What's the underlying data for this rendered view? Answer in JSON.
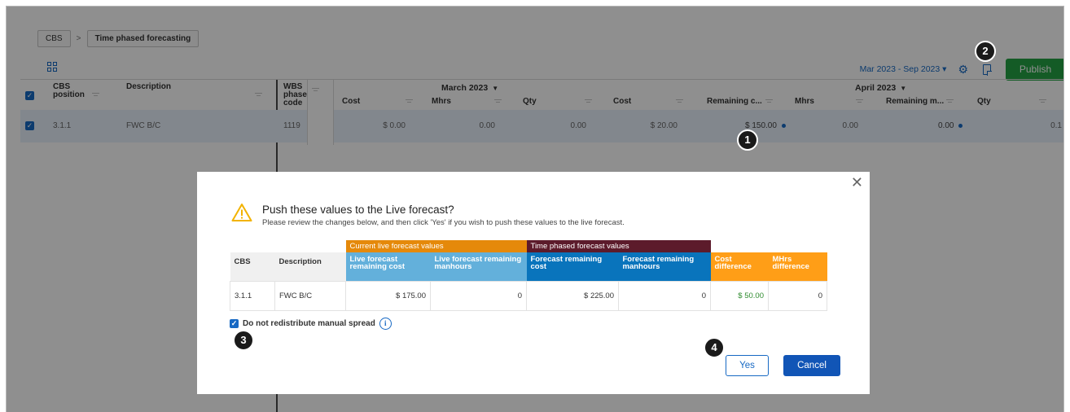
{
  "breadcrumb": {
    "root": "CBS",
    "separator": ">",
    "current": "Time phased forecasting"
  },
  "toolbar": {
    "date_range": "Mar 2023 - Sep 2023 ▾",
    "publish_label": "Publish"
  },
  "grid": {
    "headers": {
      "cbs_position": "CBS position",
      "description": "Description",
      "wbs": "WBS phase code",
      "month1": "March 2023",
      "month2": "April 2023",
      "cols_m1": [
        "Cost",
        "Mhrs",
        "Qty"
      ],
      "cols_m2": [
        "Cost",
        "Remaining c...",
        "Mhrs",
        "Remaining m...",
        "Qty"
      ]
    },
    "row": {
      "cbs": "3.1.1",
      "description": "FWC B/C",
      "wbs": "1119",
      "m1_cost": "$ 0.00",
      "m1_mhrs": "0.00",
      "m1_qty": "0.00",
      "m2_cost": "$ 20.00",
      "m2_rem_cost": "$ 150.00",
      "m2_mhrs": "0.00",
      "m2_rem_mhrs": "0.00",
      "m2_qty": "0.1"
    }
  },
  "modal": {
    "title": "Push these values to the Live forecast?",
    "subtitle": "Please review the changes below, and then click 'Yes' if you wish to push these values to the live forecast.",
    "group_current": "Current live forecast values",
    "group_phased": "Time phased forecast values",
    "columns": [
      "CBS",
      "Description",
      "Live forecast remaining cost",
      "Live forecast remaining manhours",
      "Forecast remaining cost",
      "Forecast remaining manhours",
      "Cost difference",
      "MHrs difference"
    ],
    "row": [
      "3.1.1",
      "FWC B/C",
      "$ 175.00",
      "0",
      "$ 225.00",
      "0",
      "$ 50.00",
      "0"
    ],
    "checkbox_label": "Do not redistribute manual spread",
    "info_glyph": "i",
    "yes_label": "Yes",
    "cancel_label": "Cancel",
    "close_glyph": "✕"
  },
  "callouts": [
    "1",
    "2",
    "3",
    "4"
  ],
  "colors": {
    "accent": "#1769c4",
    "publish": "#25a244",
    "orange": "#e5890a",
    "maroon": "#5c1b2b",
    "light_blue": "#63b0db",
    "dark_blue": "#0974bc",
    "diff_orange": "#ff9e17"
  }
}
